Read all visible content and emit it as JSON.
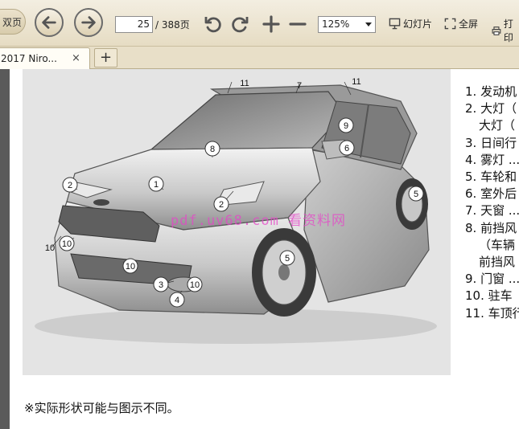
{
  "toolbar": {
    "dual_page_label": "双页",
    "page_current": "25",
    "page_total": "/ 388页",
    "zoom_value": "125%",
    "slideshow_label": "幻灯片",
    "fullscreen_label": "全屏",
    "print_label": "打印"
  },
  "tabs": {
    "active_title": "2017 Niro...",
    "close_glyph": "×",
    "add_glyph": "+"
  },
  "document": {
    "watermark": "pdf.uv68.com 看资料网",
    "callouts": [
      "11",
      "7",
      "11",
      "9",
      "6",
      "8",
      "2",
      "1",
      "2",
      "5",
      "10",
      "10",
      "10",
      "5",
      "3",
      "10",
      "4"
    ],
    "legend": [
      "1. 发动机",
      "2. 大灯（",
      "大灯（",
      "3. 日间行",
      "4. 雾灯 ...",
      "5. 车轮和",
      "6. 室外后",
      "7. 天窗 ...",
      "8. 前挡风",
      "（车辆",
      "前挡风",
      "9. 门窗 ...",
      "10. 驻车",
      "11. 车顶行"
    ],
    "footnote": "※实际形状可能与图示不同。"
  },
  "colors": {
    "toolbar_bg": "#e9e0c8",
    "viewer_bg": "#5a5a5a",
    "watermark": "#e646c8"
  }
}
